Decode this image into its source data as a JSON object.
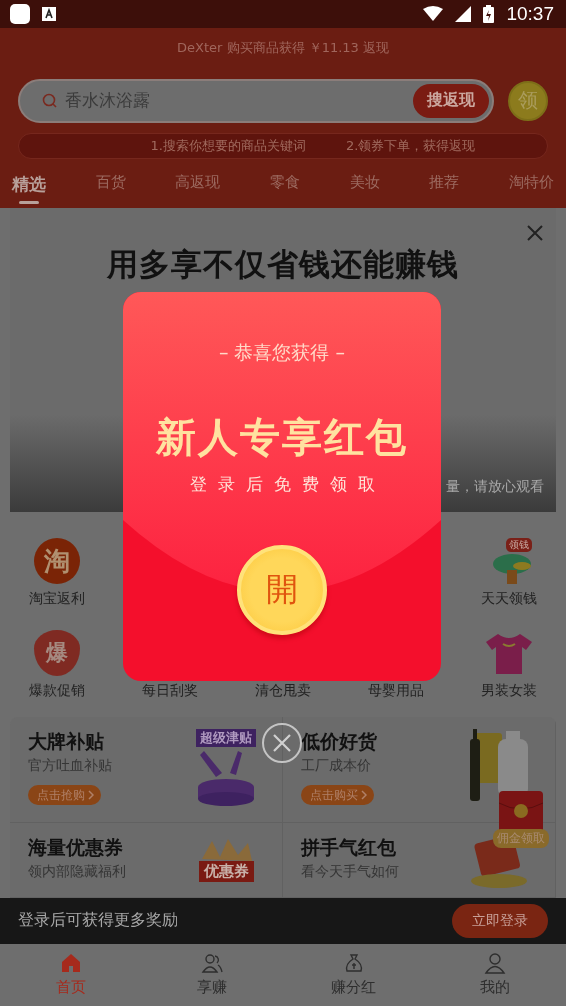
{
  "status_bar": {
    "time": "10:37"
  },
  "announcement": "DeXter 购买商品获得 ￥11.13 返现",
  "search": {
    "value": "香水沐浴露",
    "button": "搜返现",
    "coin": "领"
  },
  "tips": [
    "1.搜索你想要的商品关键词",
    "2.领券下单，获得返现"
  ],
  "tabs": [
    {
      "label": "精选",
      "selected": true
    },
    {
      "label": "百货",
      "selected": false
    },
    {
      "label": "高返现",
      "selected": false
    },
    {
      "label": "零食",
      "selected": false
    },
    {
      "label": "美妆",
      "selected": false
    },
    {
      "label": "推荐",
      "selected": false
    },
    {
      "label": "淘特价",
      "selected": false
    }
  ],
  "banner": {
    "title": "用多享不仅省钱还能赚钱",
    "caption": "量，请放心观看"
  },
  "shortcuts": [
    {
      "kind": "tao",
      "badge": "淘",
      "label": "淘宝返利"
    },
    {
      "kind": "hidden"
    },
    {
      "kind": "hidden"
    },
    {
      "kind": "hidden"
    },
    {
      "kind": "tree",
      "badge": "领钱",
      "label": "天天领钱"
    },
    {
      "kind": "fire",
      "badge": "爆",
      "label": "爆款促销"
    },
    {
      "kind": "hidden",
      "label": "每日刮奖"
    },
    {
      "kind": "hidden",
      "label": "清仓甩卖"
    },
    {
      "kind": "hidden",
      "label": "母婴用品"
    },
    {
      "kind": "shirt",
      "label": "男装女装"
    }
  ],
  "cards": [
    {
      "title": "大牌补贴",
      "subtitle": "官方吐血补贴",
      "button": "点击抢购",
      "kind": "cosmetics",
      "art_label": "超级津贴"
    },
    {
      "title": "低价好货",
      "subtitle": "工厂成本价",
      "button": "点击购买",
      "kind": "bottles"
    },
    {
      "title": "海量优惠券",
      "subtitle": "领内部隐藏福利",
      "kind": "coupon",
      "art_label": "优惠券"
    },
    {
      "title": "拼手气红包",
      "subtitle": "看今天手气如何",
      "kind": "envelopes"
    }
  ],
  "floating_badge": "佣金领取",
  "login_bar": {
    "text": "登录后可获得更多奖励",
    "button": "立即登录"
  },
  "nav": [
    {
      "label": "首页",
      "kind": "home",
      "selected": true
    },
    {
      "label": "享赚",
      "kind": "people",
      "selected": false
    },
    {
      "label": "赚分红",
      "kind": "moneybag",
      "selected": false
    },
    {
      "label": "我的",
      "kind": "person",
      "selected": false
    }
  ],
  "modal": {
    "subtitle": "– 恭喜您获得 –",
    "title": "新人专享红包",
    "note": "登录后免费领取",
    "open_button": "開"
  }
}
